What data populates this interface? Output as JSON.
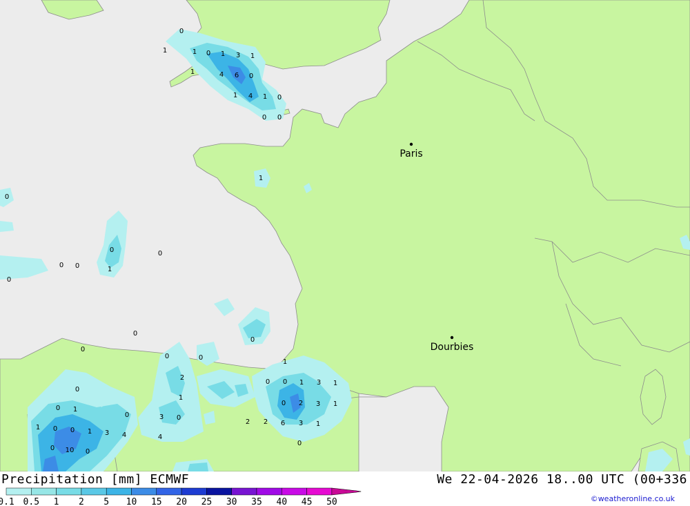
{
  "footer": {
    "title": "Precipitation [mm] ECMWF",
    "datetime": "We 22-04-2026 18..00 UTC (00+336",
    "credit": "©weatheronline.co.uk"
  },
  "legend": {
    "ticks": [
      "0.1",
      "0.5",
      "1",
      "2",
      "5",
      "10",
      "15",
      "20",
      "25",
      "30",
      "35",
      "40",
      "45",
      "50"
    ],
    "colors": [
      "#b4f0f0",
      "#96e6e6",
      "#78dce6",
      "#5ac8e6",
      "#3cb4e6",
      "#3c8ce6",
      "#3264e6",
      "#1e3cd2",
      "#0a14a0",
      "#7814d2",
      "#a00ae6",
      "#c80ae6",
      "#e60ad2",
      "#c80a96"
    ]
  },
  "colors": {
    "sea": "#ececec",
    "land": "#c8f5a0",
    "border": "#8c8c8c",
    "precip_light": "#b4f0f0",
    "precip_mid": "#78dce6",
    "precip_heavy": "#3cb4e6"
  },
  "cities": [
    {
      "name": "Paris"
    },
    {
      "name": "Dourbies"
    }
  ],
  "map_values": [
    "0",
    "1",
    "1",
    "0",
    "1",
    "3",
    "1",
    "1",
    "4",
    "6",
    "0",
    "1",
    "4",
    "1",
    "0",
    "0",
    "0",
    "1",
    "0",
    "0",
    "1",
    "0",
    "0",
    "0",
    "0",
    "0",
    "0",
    "0",
    "0",
    "0",
    "1",
    "2",
    "0",
    "0",
    "1",
    "3",
    "1",
    "0",
    "1",
    "0",
    "2",
    "3",
    "1",
    "0",
    "1",
    "0",
    "3",
    "0",
    "2",
    "2",
    "6",
    "3",
    "1",
    "1",
    "0",
    "0",
    "1",
    "3",
    "4",
    "4",
    "0",
    "0",
    "10",
    "0"
  ]
}
